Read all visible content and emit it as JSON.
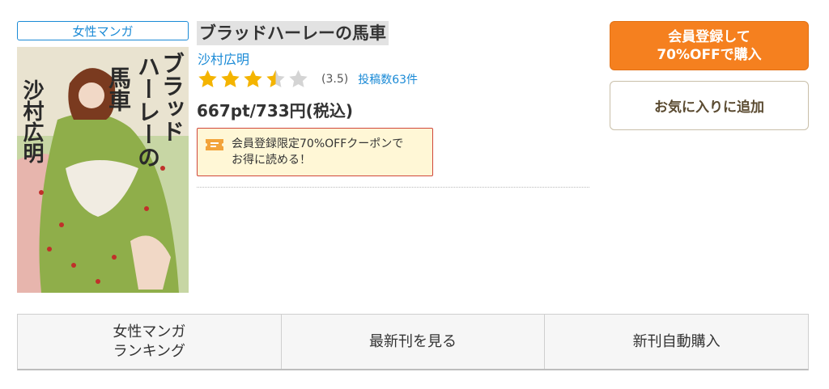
{
  "genre": {
    "label": "女性マンガ"
  },
  "book": {
    "title": "ブラッドハーレーの馬車",
    "author": "沙村広明",
    "rating": 3.5,
    "rating_text": "(3.5)",
    "review_text": "投稿数63件",
    "price": "667pt/733円(税込)",
    "cover_art_text": [
      "ブラッド",
      "ハーレーの",
      "馬車",
      "沙村広明"
    ]
  },
  "coupon": {
    "line1": "会員登録限定70%OFFクーポンで",
    "line2": "お得に読める！",
    "icon": "coupon-ticket-icon"
  },
  "actions": {
    "register_line1": "会員登録して",
    "register_line2": "70%OFFで購入",
    "favorite": "お気に入りに追加"
  },
  "nav": {
    "ranking_line1": "女性マンガ",
    "ranking_line2": "ランキング",
    "latest": "最新刊を見る",
    "auto_buy": "新刊自動購入"
  },
  "colors": {
    "accent_blue": "#1a8ad6",
    "orange": "#f5801f",
    "star_gold": "#f4b400",
    "star_empty": "#d4d4d4",
    "coupon_border": "#d0473b",
    "coupon_bg": "#fff7d6"
  }
}
